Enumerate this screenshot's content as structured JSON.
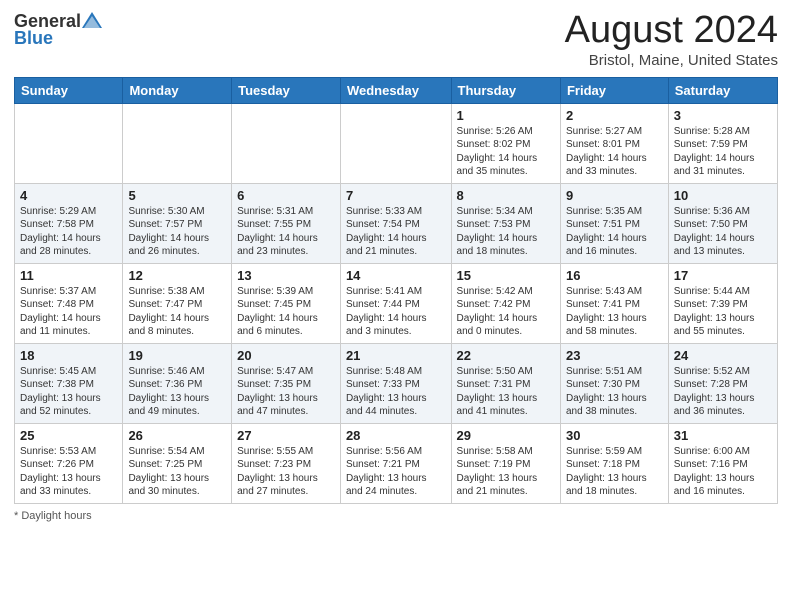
{
  "header": {
    "logo_general": "General",
    "logo_blue": "Blue",
    "title": "August 2024",
    "subtitle": "Bristol, Maine, United States"
  },
  "days_of_week": [
    "Sunday",
    "Monday",
    "Tuesday",
    "Wednesday",
    "Thursday",
    "Friday",
    "Saturday"
  ],
  "weeks": [
    {
      "row_class": "week-odd",
      "days": [
        {
          "num": "",
          "info": ""
        },
        {
          "num": "",
          "info": ""
        },
        {
          "num": "",
          "info": ""
        },
        {
          "num": "",
          "info": ""
        },
        {
          "num": "1",
          "info": "Sunrise: 5:26 AM\nSunset: 8:02 PM\nDaylight: 14 hours and 35 minutes."
        },
        {
          "num": "2",
          "info": "Sunrise: 5:27 AM\nSunset: 8:01 PM\nDaylight: 14 hours and 33 minutes."
        },
        {
          "num": "3",
          "info": "Sunrise: 5:28 AM\nSunset: 7:59 PM\nDaylight: 14 hours and 31 minutes."
        }
      ]
    },
    {
      "row_class": "week-even",
      "days": [
        {
          "num": "4",
          "info": "Sunrise: 5:29 AM\nSunset: 7:58 PM\nDaylight: 14 hours and 28 minutes."
        },
        {
          "num": "5",
          "info": "Sunrise: 5:30 AM\nSunset: 7:57 PM\nDaylight: 14 hours and 26 minutes."
        },
        {
          "num": "6",
          "info": "Sunrise: 5:31 AM\nSunset: 7:55 PM\nDaylight: 14 hours and 23 minutes."
        },
        {
          "num": "7",
          "info": "Sunrise: 5:33 AM\nSunset: 7:54 PM\nDaylight: 14 hours and 21 minutes."
        },
        {
          "num": "8",
          "info": "Sunrise: 5:34 AM\nSunset: 7:53 PM\nDaylight: 14 hours and 18 minutes."
        },
        {
          "num": "9",
          "info": "Sunrise: 5:35 AM\nSunset: 7:51 PM\nDaylight: 14 hours and 16 minutes."
        },
        {
          "num": "10",
          "info": "Sunrise: 5:36 AM\nSunset: 7:50 PM\nDaylight: 14 hours and 13 minutes."
        }
      ]
    },
    {
      "row_class": "week-odd",
      "days": [
        {
          "num": "11",
          "info": "Sunrise: 5:37 AM\nSunset: 7:48 PM\nDaylight: 14 hours and 11 minutes."
        },
        {
          "num": "12",
          "info": "Sunrise: 5:38 AM\nSunset: 7:47 PM\nDaylight: 14 hours and 8 minutes."
        },
        {
          "num": "13",
          "info": "Sunrise: 5:39 AM\nSunset: 7:45 PM\nDaylight: 14 hours and 6 minutes."
        },
        {
          "num": "14",
          "info": "Sunrise: 5:41 AM\nSunset: 7:44 PM\nDaylight: 14 hours and 3 minutes."
        },
        {
          "num": "15",
          "info": "Sunrise: 5:42 AM\nSunset: 7:42 PM\nDaylight: 14 hours and 0 minutes."
        },
        {
          "num": "16",
          "info": "Sunrise: 5:43 AM\nSunset: 7:41 PM\nDaylight: 13 hours and 58 minutes."
        },
        {
          "num": "17",
          "info": "Sunrise: 5:44 AM\nSunset: 7:39 PM\nDaylight: 13 hours and 55 minutes."
        }
      ]
    },
    {
      "row_class": "week-even",
      "days": [
        {
          "num": "18",
          "info": "Sunrise: 5:45 AM\nSunset: 7:38 PM\nDaylight: 13 hours and 52 minutes."
        },
        {
          "num": "19",
          "info": "Sunrise: 5:46 AM\nSunset: 7:36 PM\nDaylight: 13 hours and 49 minutes."
        },
        {
          "num": "20",
          "info": "Sunrise: 5:47 AM\nSunset: 7:35 PM\nDaylight: 13 hours and 47 minutes."
        },
        {
          "num": "21",
          "info": "Sunrise: 5:48 AM\nSunset: 7:33 PM\nDaylight: 13 hours and 44 minutes."
        },
        {
          "num": "22",
          "info": "Sunrise: 5:50 AM\nSunset: 7:31 PM\nDaylight: 13 hours and 41 minutes."
        },
        {
          "num": "23",
          "info": "Sunrise: 5:51 AM\nSunset: 7:30 PM\nDaylight: 13 hours and 38 minutes."
        },
        {
          "num": "24",
          "info": "Sunrise: 5:52 AM\nSunset: 7:28 PM\nDaylight: 13 hours and 36 minutes."
        }
      ]
    },
    {
      "row_class": "week-odd",
      "days": [
        {
          "num": "25",
          "info": "Sunrise: 5:53 AM\nSunset: 7:26 PM\nDaylight: 13 hours and 33 minutes."
        },
        {
          "num": "26",
          "info": "Sunrise: 5:54 AM\nSunset: 7:25 PM\nDaylight: 13 hours and 30 minutes."
        },
        {
          "num": "27",
          "info": "Sunrise: 5:55 AM\nSunset: 7:23 PM\nDaylight: 13 hours and 27 minutes."
        },
        {
          "num": "28",
          "info": "Sunrise: 5:56 AM\nSunset: 7:21 PM\nDaylight: 13 hours and 24 minutes."
        },
        {
          "num": "29",
          "info": "Sunrise: 5:58 AM\nSunset: 7:19 PM\nDaylight: 13 hours and 21 minutes."
        },
        {
          "num": "30",
          "info": "Sunrise: 5:59 AM\nSunset: 7:18 PM\nDaylight: 13 hours and 18 minutes."
        },
        {
          "num": "31",
          "info": "Sunrise: 6:00 AM\nSunset: 7:16 PM\nDaylight: 13 hours and 16 minutes."
        }
      ]
    }
  ],
  "footer": {
    "note": "* Daylight hours"
  }
}
